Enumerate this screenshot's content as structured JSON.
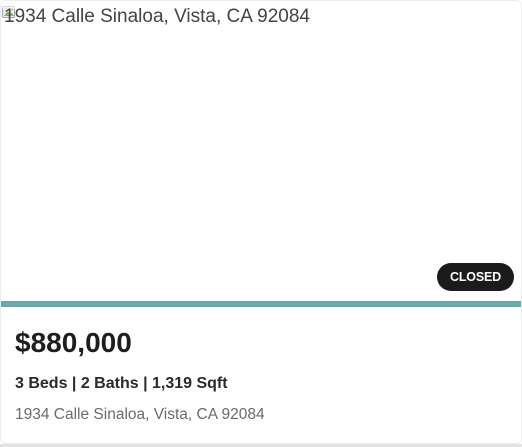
{
  "listing": {
    "image_alt": "1934 Calle Sinaloa, Vista, CA 92084",
    "status": "CLOSED",
    "price": "$880,000",
    "specs": "3 Beds | 2 Baths | 1,319 Sqft",
    "address": "1934 Calle Sinaloa, Vista, CA 92084"
  },
  "icons": {
    "broken_image": "broken-image-icon"
  },
  "colors": {
    "accent_bar": "#6aa8b0",
    "badge_background": "#1b1b1b",
    "badge_text": "#ffffff",
    "price_text": "#1e1e1e",
    "address_text": "#6b6b6b"
  }
}
